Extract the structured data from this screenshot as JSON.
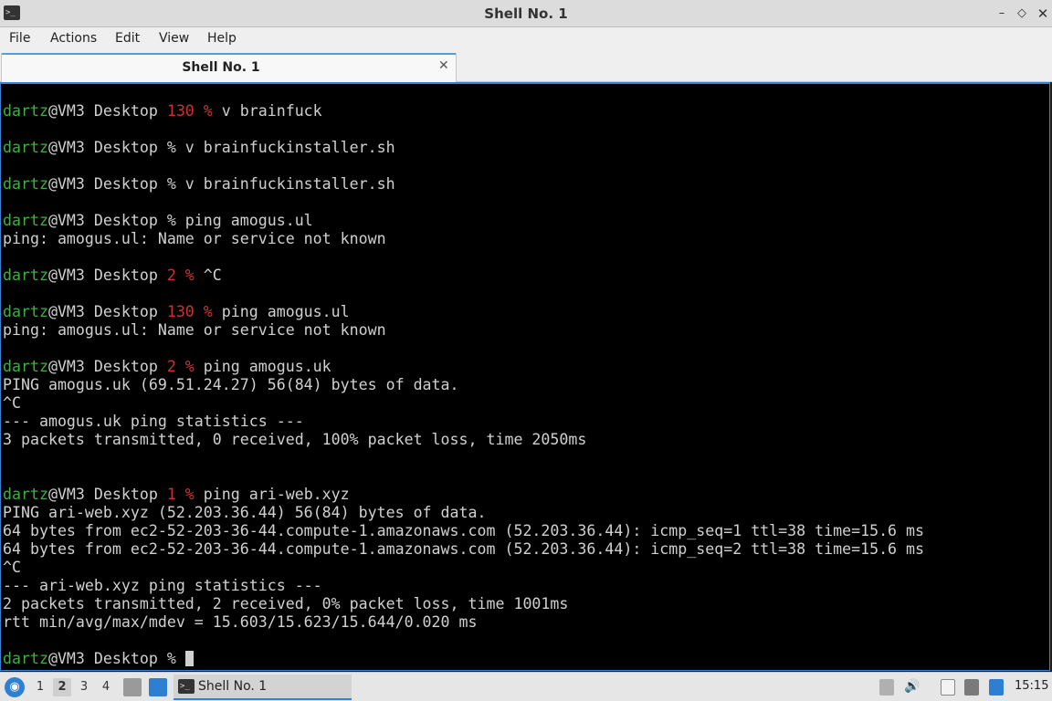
{
  "window": {
    "title": "Shell No. 1",
    "controls": {
      "minimize": "–",
      "maximize": "◇",
      "close": "✕"
    }
  },
  "menu": [
    "File",
    "Actions",
    "Edit",
    "View",
    "Help"
  ],
  "tab": {
    "label": "Shell No. 1",
    "close": "✕"
  },
  "terminal": {
    "lines": [
      {
        "user": "dartz",
        "rest": "@VM3 Desktop ",
        "code": "130 %",
        "cmd": " v brainfuck"
      },
      {
        "text": ""
      },
      {
        "user": "dartz",
        "rest": "@VM3 Desktop % v brainfuckinstaller.sh"
      },
      {
        "text": ""
      },
      {
        "user": "dartz",
        "rest": "@VM3 Desktop % v brainfuckinstaller.sh"
      },
      {
        "text": ""
      },
      {
        "user": "dartz",
        "rest": "@VM3 Desktop % ping amogus.ul"
      },
      {
        "text": "ping: amogus.ul: Name or service not known"
      },
      {
        "text": ""
      },
      {
        "user": "dartz",
        "rest": "@VM3 Desktop ",
        "code": "2 %",
        "cmd": " ^C"
      },
      {
        "text": ""
      },
      {
        "user": "dartz",
        "rest": "@VM3 Desktop ",
        "code": "130 %",
        "cmd": " ping amogus.ul"
      },
      {
        "text": "ping: amogus.ul: Name or service not known"
      },
      {
        "text": ""
      },
      {
        "user": "dartz",
        "rest": "@VM3 Desktop ",
        "code": "2 %",
        "cmd": " ping amogus.uk"
      },
      {
        "text": "PING amogus.uk (69.51.24.27) 56(84) bytes of data."
      },
      {
        "text": "^C"
      },
      {
        "text": "--- amogus.uk ping statistics ---"
      },
      {
        "text": "3 packets transmitted, 0 received, 100% packet loss, time 2050ms"
      },
      {
        "text": ""
      },
      {
        "text": ""
      },
      {
        "user": "dartz",
        "rest": "@VM3 Desktop ",
        "code": "1 %",
        "cmd": " ping ari-web.xyz"
      },
      {
        "text": "PING ari-web.xyz (52.203.36.44) 56(84) bytes of data."
      },
      {
        "text": "64 bytes from ec2-52-203-36-44.compute-1.amazonaws.com (52.203.36.44): icmp_seq=1 ttl=38 time=15.6 ms"
      },
      {
        "text": "64 bytes from ec2-52-203-36-44.compute-1.amazonaws.com (52.203.36.44): icmp_seq=2 ttl=38 time=15.6 ms"
      },
      {
        "text": "^C"
      },
      {
        "text": "--- ari-web.xyz ping statistics ---"
      },
      {
        "text": "2 packets transmitted, 2 received, 0% packet loss, time 1001ms"
      },
      {
        "text": "rtt min/avg/max/mdev = 15.603/15.623/15.644/0.020 ms"
      },
      {
        "text": ""
      },
      {
        "user": "dartz",
        "rest": "@VM3 Desktop % ",
        "cursor": true
      }
    ]
  },
  "taskbar": {
    "workspaces": [
      "1",
      "2",
      "3",
      "4"
    ],
    "active_workspace": "2",
    "task_label": "Shell No. 1",
    "clock": "15:15",
    "tray_icons": [
      "arrow-up-icon",
      "volume-icon",
      "clipboard-icon",
      "network-icon",
      "bluetooth-icon"
    ]
  },
  "colors": {
    "prompt_user": "#3cb13c",
    "error_code": "#d03030",
    "terminal_bg": "#000000",
    "accent": "#3b7fd1"
  }
}
